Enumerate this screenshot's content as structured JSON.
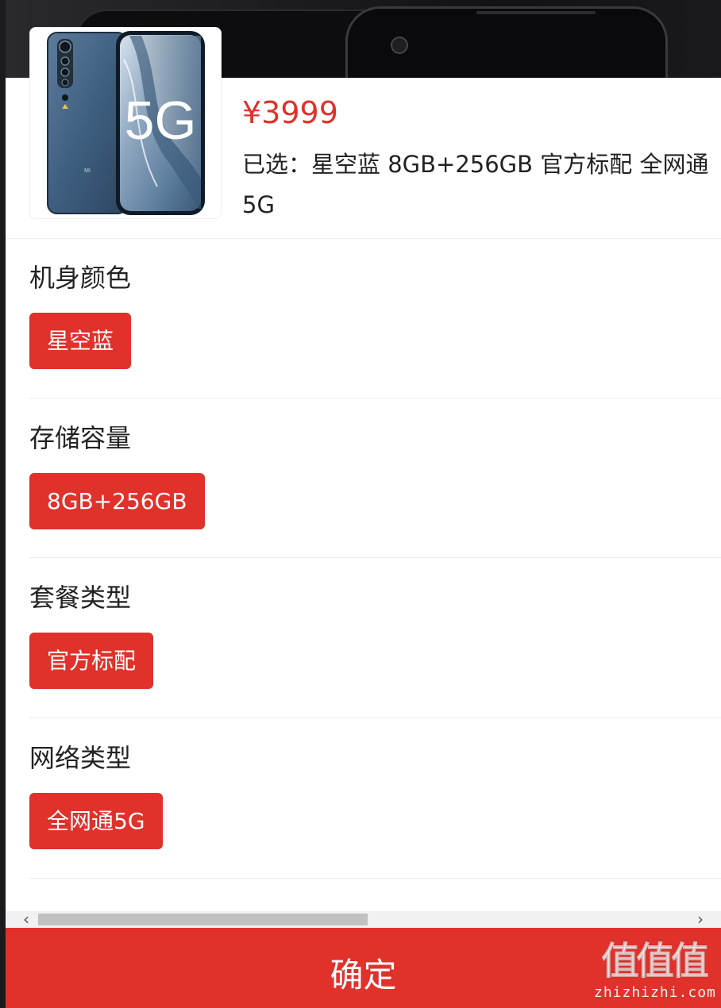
{
  "product": {
    "price": "¥3999",
    "selected_summary": "已选：星空蓝 8GB+256GB 官方标配 全网通5G",
    "image_badge_text": "5G",
    "image_brand_mark": "MI"
  },
  "spec_groups": [
    {
      "title": "机身颜色",
      "option": "星空蓝"
    },
    {
      "title": "存储容量",
      "option": "8GB+256GB"
    },
    {
      "title": "套餐类型",
      "option": "官方标配"
    },
    {
      "title": "网络类型",
      "option": "全网通5G"
    }
  ],
  "scrollbar": {
    "left_arrow": "‹",
    "right_arrow": "›",
    "position": 0.0
  },
  "confirm_label": "确定",
  "watermark": {
    "glyphs": "值值值",
    "domain": "zhizhizhi.com"
  },
  "colors": {
    "accent": "#e0312b",
    "text": "#222222",
    "background": "#ffffff"
  },
  "icons": [
    "chevron-left-icon",
    "chevron-right-icon"
  ]
}
